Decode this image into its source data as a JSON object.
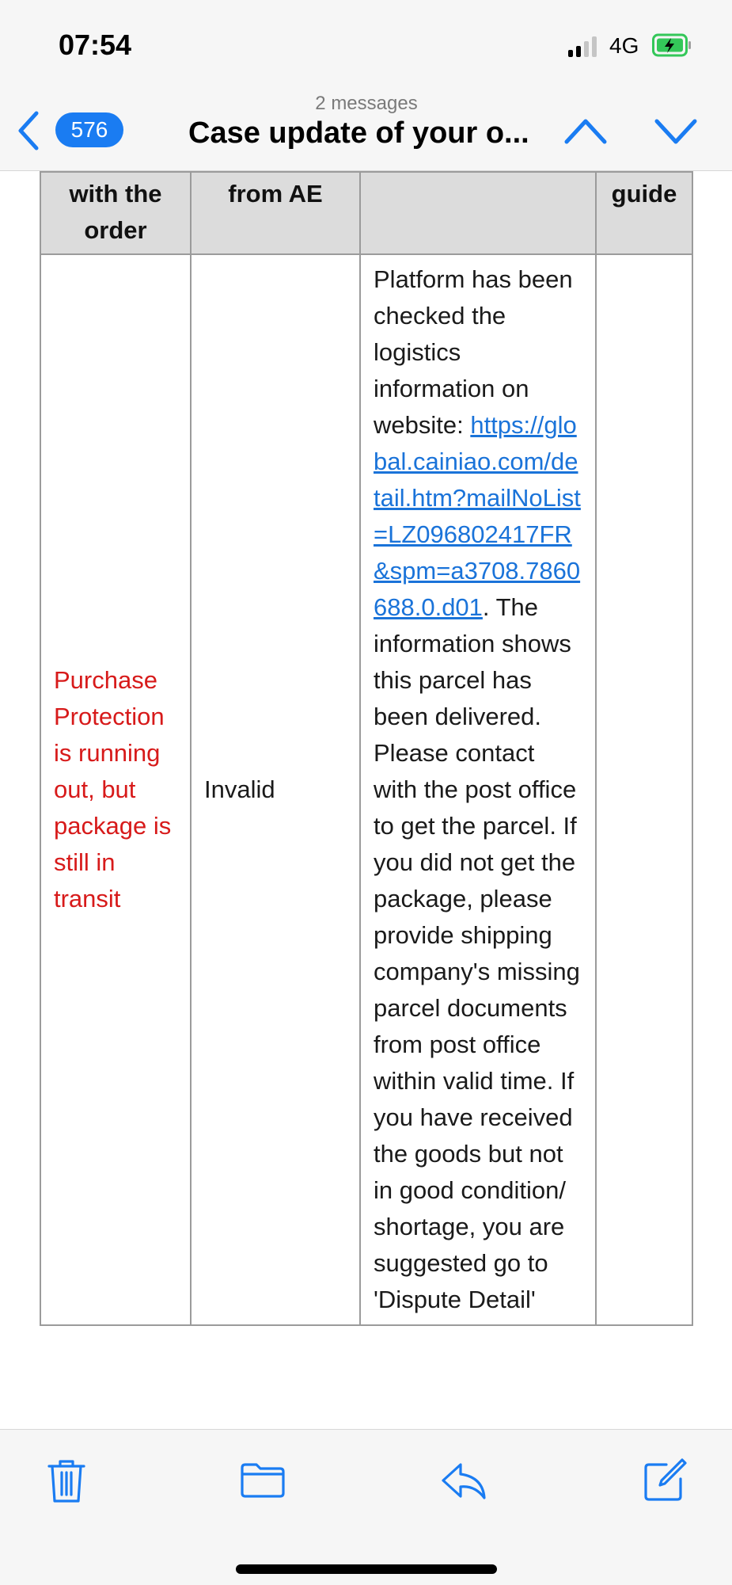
{
  "status_bar": {
    "time": "07:54",
    "network": "4G",
    "signal_icon": "cellular-signal-icon",
    "battery_icon": "battery-charging-icon"
  },
  "nav": {
    "unread_count": "576",
    "message_count": "2 messages",
    "subject": "Case update of your o...",
    "back_icon": "chevron-left-icon",
    "prev_icon": "chevron-up-icon",
    "next_icon": "chevron-down-icon"
  },
  "table": {
    "headers": [
      "with the order",
      "from AE",
      "",
      "guide"
    ],
    "row": {
      "situation": "Purchase Protection is running out, but package is still in transit",
      "result": "Invalid",
      "reply_before_link": "Platform has been checked the logistics information on website: ",
      "link_text": "https://global.cainiao.com/detail.htm?mailNoList=LZ096802417FR&spm=a3708.7860688.0.d01",
      "reply_after_link": ". The information shows this parcel has been delivered. Please contact with the post office to get the parcel. If you did not get the package, please provide shipping company's missing parcel documents from post office within valid time. If you have received the goods but not in good condition/ shortage, you are suggested go to 'Dispute Detail'",
      "guide": ""
    }
  },
  "colors": {
    "accent": "#1a7cf2",
    "warning_text": "#d71a1a",
    "link": "#1a73d9"
  },
  "toolbar": {
    "icons": [
      "trash-icon",
      "folder-icon",
      "reply-icon",
      "compose-icon"
    ]
  }
}
